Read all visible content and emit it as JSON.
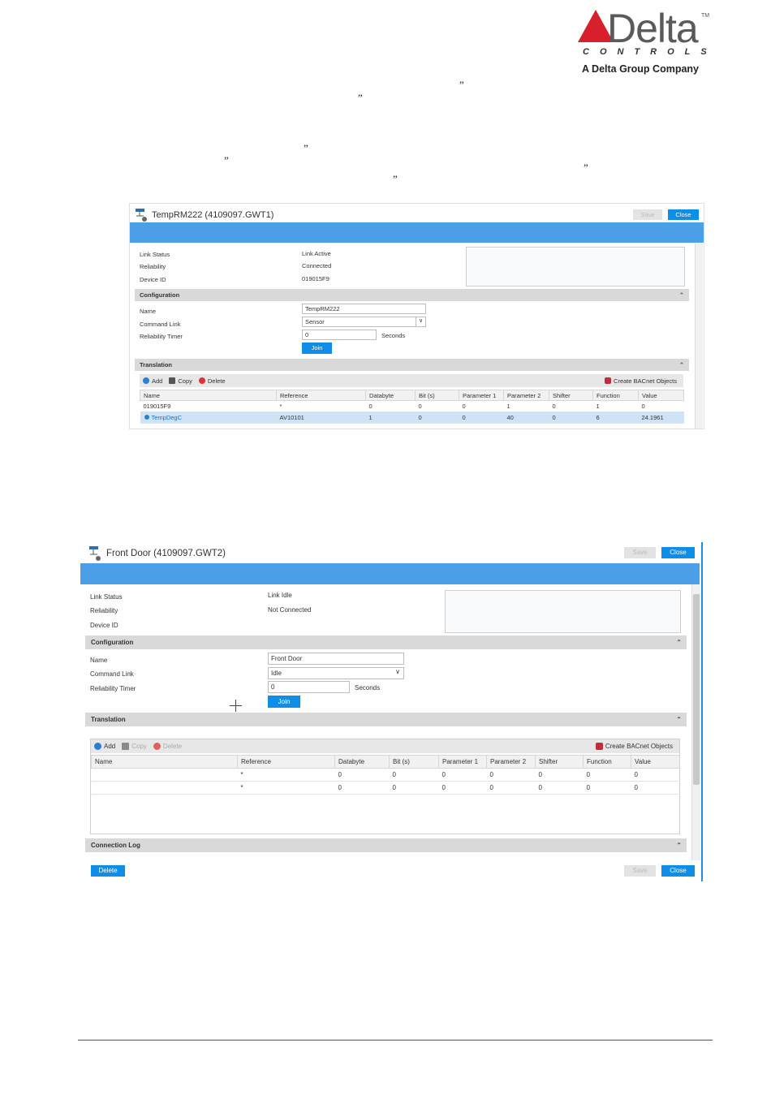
{
  "brand": {
    "wordmark": "Delta",
    "tm": "TM",
    "controls": "CONTROLS",
    "tagline": "A Delta Group Company",
    "accent_color": "#d7202c"
  },
  "quote_mark": "”",
  "window1": {
    "title": "TempRM222 (4109097.GWT1)",
    "save_label": "Save",
    "close_label": "Close",
    "link_status_label": "Link Status",
    "link_status_value": "Link Active",
    "reliability_label": "Reliability",
    "reliability_value": "Connected",
    "device_id_label": "Device ID",
    "device_id_value": "019015F9",
    "configuration_header": "Configuration",
    "name_label": "Name",
    "name_value": "TempRM222",
    "command_link_label": "Command Link",
    "command_link_value": "Sensor",
    "reliability_timer_label": "Reliability Timer",
    "reliability_timer_value": "0",
    "seconds_label": "Seconds",
    "join_label": "Join",
    "translation_header": "Translation",
    "toolbar": {
      "add": "Add",
      "copy": "Copy",
      "delete": "Delete",
      "create": "Create BACnet Objects"
    },
    "columns": [
      "Name",
      "Reference",
      "Databyte",
      "Bit (s)",
      "Parameter 1",
      "Parameter 2",
      "Shifter",
      "Function",
      "Value"
    ],
    "rows": [
      [
        "019015F9",
        "*",
        "0",
        "0",
        "0",
        "1",
        "0",
        "1",
        "0"
      ],
      [
        "TempDegC",
        "AV10101",
        "1",
        "0",
        "0",
        "40",
        "0",
        "6",
        "24.1961"
      ]
    ]
  },
  "window2": {
    "title": "Front Door (4109097.GWT2)",
    "save_label": "Save",
    "close_label": "Close",
    "link_status_label": "Link Status",
    "link_status_value": "Link Idle",
    "reliability_label": "Reliability",
    "reliability_value": "Not Connected",
    "device_id_label": "Device ID",
    "device_id_value": "",
    "configuration_header": "Configuration",
    "name_label": "Name",
    "name_value": "Front Door",
    "command_link_label": "Command Link",
    "command_link_value": "Idle",
    "reliability_timer_label": "Reliability Timer",
    "reliability_timer_value": "0",
    "seconds_label": "Seconds",
    "join_label": "Join",
    "translation_header": "Translation",
    "toolbar": {
      "add": "Add",
      "copy": "Copy",
      "delete": "Delete",
      "create": "Create BACnet Objects"
    },
    "columns": [
      "Name",
      "Reference",
      "Databyte",
      "Bit (s)",
      "Parameter 1",
      "Parameter 2",
      "Shifter",
      "Function",
      "Value"
    ],
    "rows": [
      [
        "",
        "*",
        "0",
        "0",
        "0",
        "0",
        "0",
        "0",
        "0"
      ],
      [
        "",
        "*",
        "0",
        "0",
        "0",
        "0",
        "0",
        "0",
        "0"
      ]
    ],
    "connection_log_header": "Connection Log",
    "delete_label": "Delete"
  }
}
